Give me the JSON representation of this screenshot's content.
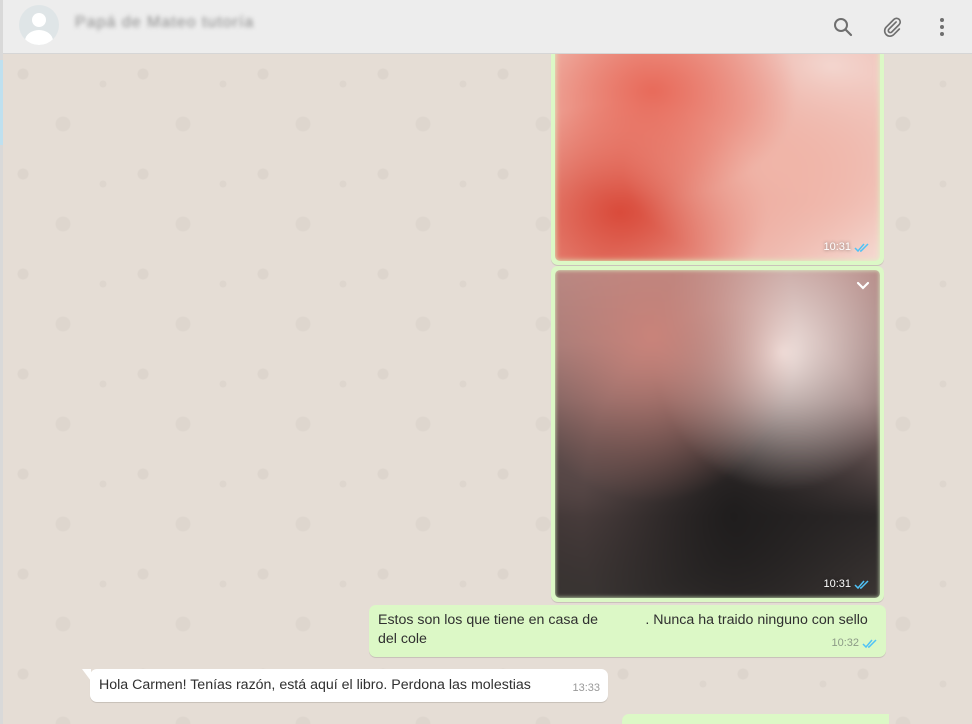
{
  "header": {
    "contact_name": "Papá de Mateo tutoría",
    "icons": [
      "search-icon",
      "attach-icon",
      "menu-icon"
    ]
  },
  "messages": [
    {
      "type": "image",
      "direction": "out",
      "time": "10:31",
      "status": "read"
    },
    {
      "type": "image",
      "direction": "out",
      "time": "10:31",
      "status": "read"
    },
    {
      "type": "text",
      "direction": "out",
      "line1": "Estos son los que tiene en casa de            . Nunca ha traido ninguno con sello",
      "line2": "del cole",
      "time": "10:32",
      "status": "read"
    },
    {
      "type": "text",
      "direction": "in",
      "text": "Hola Carmen! Tenías razón, está aquí el libro. Perdona las molestias",
      "time": "13:33"
    }
  ],
  "colors": {
    "outgoing": "#dcf8c6",
    "incoming": "#ffffff",
    "read_ticks": "#4fc3f7",
    "header": "#ededed"
  }
}
